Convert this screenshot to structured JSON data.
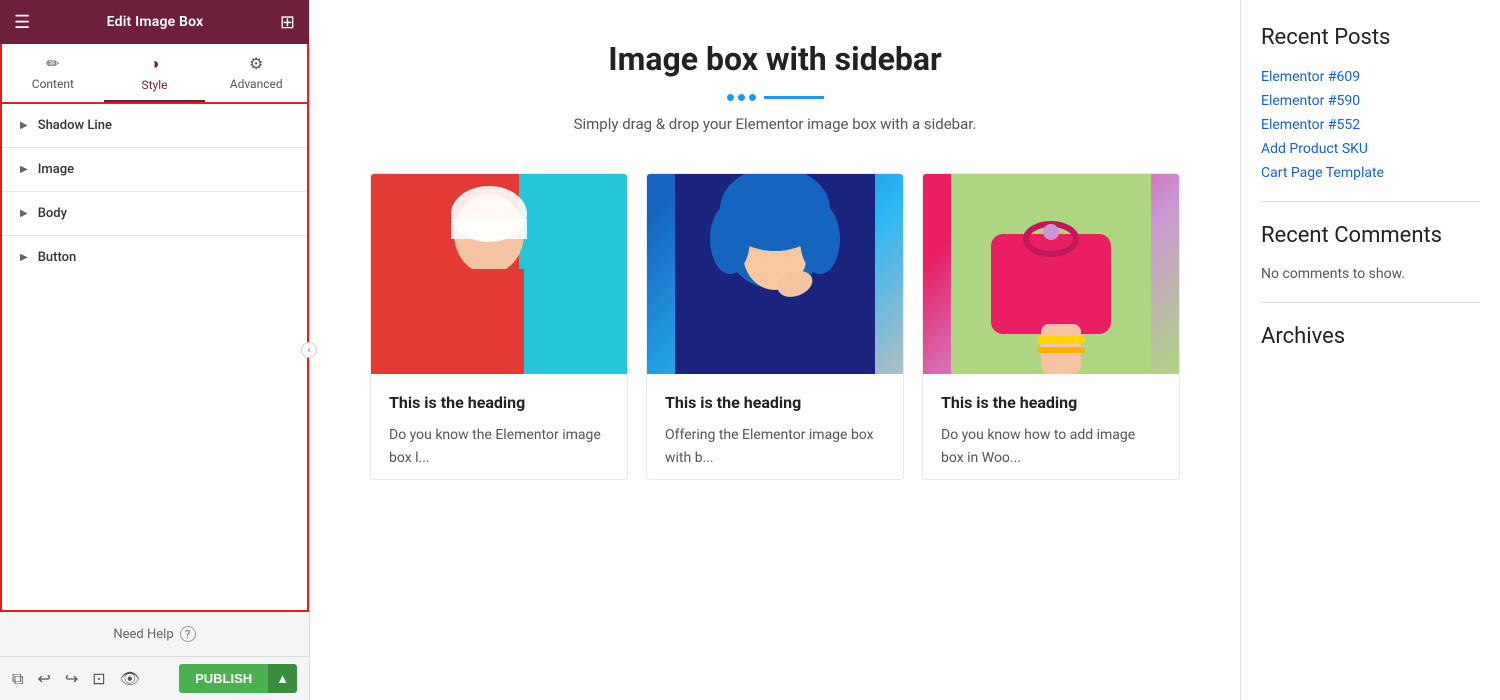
{
  "header": {
    "title": "Edit Image Box",
    "hamburger_icon": "☰",
    "grid_icon": "⊞"
  },
  "tabs": [
    {
      "id": "content",
      "label": "Content",
      "icon": "✏️"
    },
    {
      "id": "style",
      "label": "Style",
      "icon": "◑"
    },
    {
      "id": "advanced",
      "label": "Advanced",
      "icon": "⚙"
    }
  ],
  "active_tab": "style",
  "accordion": [
    {
      "label": "Shadow Line"
    },
    {
      "label": "Image"
    },
    {
      "label": "Body"
    },
    {
      "label": "Button"
    }
  ],
  "need_help": "Need Help",
  "bottom_icons": [
    "layers",
    "undo",
    "grid",
    "eye"
  ],
  "publish_label": "PUBLISH",
  "main": {
    "heading": "Image box with sidebar",
    "subtitle": "Simply drag & drop your Elementor image box with a sidebar.",
    "cards": [
      {
        "title": "This is the heading",
        "text": "Do you know the Elementor image box l...",
        "image_style": "red"
      },
      {
        "title": "This is the heading",
        "text": "Offering the Elementor image box with b...",
        "image_style": "blue"
      },
      {
        "title": "This is the heading",
        "text": "Do you know how to add image box in Woo...",
        "image_style": "pink"
      }
    ]
  },
  "sidebar": {
    "recent_posts_title": "Recent Posts",
    "links": [
      "Elementor #609",
      "Elementor #590",
      "Elementor #552",
      "Add Product SKU",
      "Cart Page Template"
    ],
    "recent_comments_title": "Recent Comments",
    "no_comments": "No comments to show.",
    "archives_title": "Archives"
  }
}
